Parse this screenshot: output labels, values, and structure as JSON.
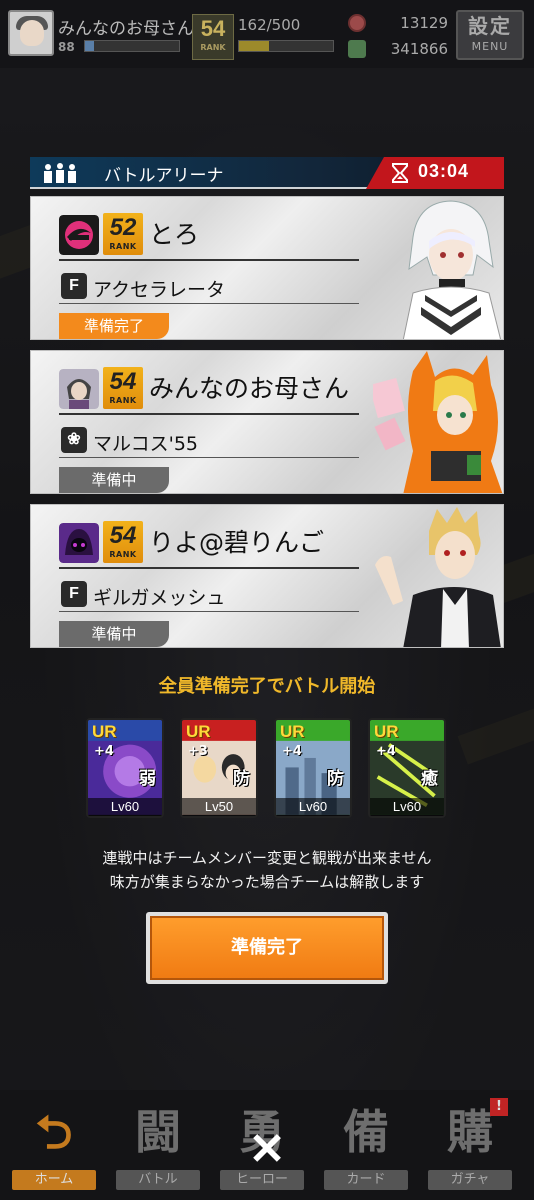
{
  "header": {
    "player_name": "みんなのお母さん",
    "level": "88",
    "rank_value": "54",
    "rank_label": "RANK",
    "stamina": "162/500",
    "coins": "13129",
    "gems": "341866",
    "menu_kanji": "設定",
    "menu_label": "MENU"
  },
  "panel": {
    "title": "バトルアリーナ",
    "timer": "03:04"
  },
  "players": [
    {
      "name": "とろ",
      "rank": "52",
      "rank_label": "RANK",
      "character_icon": "F",
      "character": "アクセラレータ",
      "status": "準備完了"
    },
    {
      "name": "みんなのお母さん",
      "rank": "54",
      "rank_label": "RANK",
      "character_icon": "flower-icon",
      "character": "マルコス'55",
      "status": "準備中"
    },
    {
      "name": "りよ@碧りんご",
      "rank": "54",
      "rank_label": "RANK",
      "character_icon": "F",
      "character": "ギルガメッシュ",
      "status": "準備中"
    }
  ],
  "notice_gold": "全員準備完了でバトル開始",
  "cards": [
    {
      "rarity": "UR",
      "plus": "+4",
      "type": "弱",
      "level": "Lv60"
    },
    {
      "rarity": "UR",
      "plus": "+3",
      "type": "防",
      "level": "Lv50"
    },
    {
      "rarity": "UR",
      "plus": "+4",
      "type": "防",
      "level": "Lv60"
    },
    {
      "rarity": "UR",
      "plus": "+4",
      "type": "癒",
      "level": "Lv60"
    }
  ],
  "notice_white": [
    "連戦中はチームメンバー変更と観戦が出来ません",
    "味方が集まらなかった場合チームは解散します"
  ],
  "ready_button": "準備完了",
  "nav": [
    {
      "big": "⮌",
      "label": "ホーム"
    },
    {
      "big": "闘",
      "label": "バトル"
    },
    {
      "big": "勇",
      "label": "ヒーロー"
    },
    {
      "big": "備",
      "label": "カード"
    },
    {
      "big": "購",
      "label": "ガチャ",
      "badge": "!"
    }
  ],
  "close_symbol": "✕",
  "colors": {
    "accent_orange": "#f38a1c",
    "timer_red": "#c2161c",
    "rank_gold": "#f2b21b",
    "notice_gold": "#f0b82a"
  }
}
